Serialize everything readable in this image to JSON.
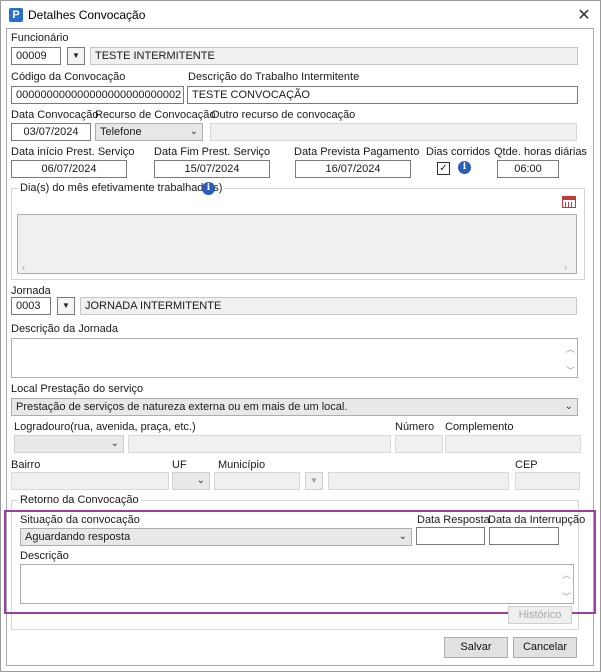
{
  "window": {
    "title": "Detalhes Convocação",
    "app_icon": "P"
  },
  "funcionario": {
    "label": "Funcionário",
    "code": "00009",
    "name": "TESTE INTERMITENTE"
  },
  "convocacao": {
    "codigo_label": "Código da Convocação",
    "codigo": "000000000000000000000000002",
    "descricao_label": "Descrição do Trabalho Intermitente",
    "descricao": "TESTE CONVOCAÇÃO",
    "data_label": "Data Convocação",
    "data": "03/07/2024",
    "recurso_label": "Recurso de Convocação",
    "recurso": "Telefone",
    "outro_label": "Outro recurso de convocação",
    "outro": ""
  },
  "servico": {
    "inicio_label": "Data início Prest. Serviço",
    "inicio": "06/07/2024",
    "fim_label": "Data Fim Prest. Serviço",
    "fim": "15/07/2024",
    "pagamento_label": "Data Prevista Pagamento",
    "pagamento": "16/07/2024",
    "dias_corridos_label": "Dias corridos",
    "dias_corridos_checked": true,
    "horas_label": "Qtde. horas diárias",
    "horas": "06:00",
    "dias_mes_label": "Dia(s) do mês efetivamente trabalhado(s)"
  },
  "jornada": {
    "label": "Jornada",
    "code": "0003",
    "name": "JORNADA INTERMITENTE",
    "descricao_label": "Descrição da Jornada",
    "descricao": ""
  },
  "local": {
    "label": "Local Prestação do serviço",
    "value": "Prestação de serviços de natureza externa ou em mais de um local.",
    "logradouro_label": "Logradouro(rua, avenida, praça, etc.)",
    "numero_label": "Número",
    "complemento_label": "Complemento",
    "bairro_label": "Bairro",
    "uf_label": "UF",
    "municipio_label": "Município",
    "cep_label": "CEP"
  },
  "retorno": {
    "group_label": "Retorno da Convocação",
    "situacao_label": "Situação da convocação",
    "situacao": "Aguardando resposta",
    "data_resposta_label": "Data Resposta",
    "data_resposta": "",
    "data_interrupcao_label": "Data da Interrupção",
    "data_interrupcao": "",
    "descricao_label": "Descrição",
    "descricao": "",
    "historico_label": "Histórico"
  },
  "footer": {
    "save_label": "Salvar",
    "cancel_label": "Cancelar"
  },
  "colors": {
    "highlight": "#9c3fa0",
    "info": "#2a5cb8",
    "calendar": "#c03a3a"
  }
}
